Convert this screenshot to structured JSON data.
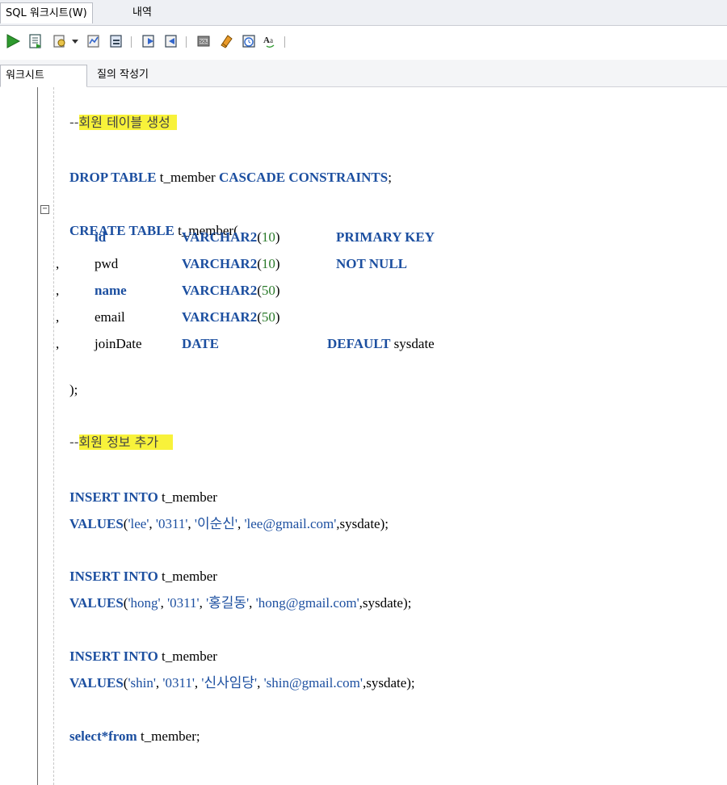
{
  "tabs": {
    "worksheet": "SQL 워크시트(W)",
    "history": "내역"
  },
  "toolbar": {
    "icons": [
      "run-statement-icon",
      "run-script-icon",
      "explain-plan-icon",
      "dropdown-arrow-icon",
      "autotrace-icon",
      "sql-tuning-icon",
      "commit-icon",
      "rollback-icon",
      "unshared-sql-icon",
      "clear-icon",
      "history-icon",
      "to-upper-lower-icon"
    ]
  },
  "subtabs": {
    "worksheet": "워크시트",
    "query_builder": "질의 작성기"
  },
  "code": {
    "comment1_dash": "--",
    "comment1_text": "회원 테이블 생성",
    "drop_kw1": "DROP TABLE",
    "drop_name": " t_member ",
    "drop_kw2": "CASCADE CONSTRAINTS",
    "drop_end": ";",
    "create_kw": "CREATE TABLE",
    "create_name": " t_member(",
    "col1_prefix": "",
    "col1_name": "id",
    "col1_type": "VARCHAR2",
    "col1_open": "(",
    "col1_len": "10",
    "col1_close": ")",
    "col1_constraint": "PRIMARY KEY",
    "col2_prefix": ",",
    "col2_name": "pwd",
    "col2_type": "VARCHAR2",
    "col2_open": "(",
    "col2_len": "10",
    "col2_close": ")",
    "col2_constraint": "NOT NULL",
    "col3_prefix": ",",
    "col3_name": "name",
    "col3_type": "VARCHAR2",
    "col3_open": "(",
    "col3_len": "50",
    "col3_close": ")",
    "col4_prefix": ",",
    "col4_name": "email",
    "col4_type": "VARCHAR2",
    "col4_open": "(",
    "col4_len": "50",
    "col4_close": ")",
    "col5_prefix": ",",
    "col5_name": "joinDate",
    "col5_type": "DATE",
    "col5_default": "DEFAULT",
    "col5_value": " sysdate",
    "create_end": ");",
    "comment2_dash": "--",
    "comment2_text": "회원 정보 추가",
    "insert_kw": "INSERT INTO",
    "insert_name": " t_member",
    "values_kw": "VALUES",
    "ins1": {
      "open": "(",
      "v1": "'lee'",
      "v2": "'0311'",
      "v3": "'이순신'",
      "v4": "'lee@gmail.com'",
      "tail": ",sysdate);"
    },
    "ins2": {
      "open": "(",
      "v1": "'hong'",
      "v2": "'0311'",
      "v3": "'홍길동'",
      "v4": "'hong@gmail.com'",
      "tail": ",sysdate);"
    },
    "ins3": {
      "open": "(",
      "v1": "'shin'",
      "v2": "'0311'",
      "v3": "'신사임당'",
      "v4": "'shin@gmail.com'",
      "tail": ",sysdate);"
    },
    "comma_sep": ", ",
    "select_kw": "select*from",
    "select_rest": " t_member;"
  },
  "colors": {
    "keyword": "#1c4fa0",
    "number": "#2a7a2a",
    "highlight": "#f8f23a",
    "run_green": "#2e9a2e"
  }
}
